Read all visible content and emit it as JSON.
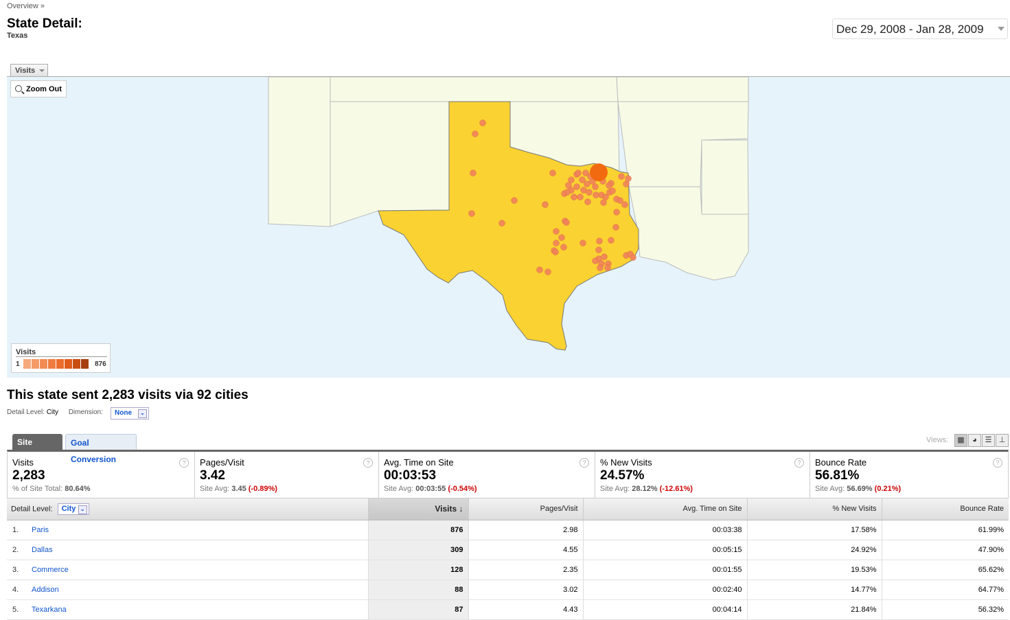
{
  "breadcrumb": "Overview »",
  "title": "State Detail:",
  "subtitle": "Texas",
  "date_range": "Dec 29, 2008 - Jan 28, 2009",
  "map": {
    "metric_tab": "Visits",
    "zoom_out_label": "Zoom Out",
    "legend": {
      "title": "Visits",
      "min": "1",
      "max": "876",
      "colors": [
        "#f6a97c",
        "#f49b69",
        "#f28c55",
        "#ef7c40",
        "#eb6c2c",
        "#e05c1c",
        "#c84e12",
        "#a64010"
      ]
    },
    "land_color": "#f7fbe6",
    "state_color": "#fad232",
    "water_color": "#e6f3fb",
    "marker_color": "#f0825a"
  },
  "summary": {
    "heading": "This state sent 2,283 visits via 92 cities",
    "detail_level_label": "Detail Level:",
    "detail_level_value": "City",
    "dimension_label": "Dimension:",
    "dimension_value": "None"
  },
  "tabs": {
    "site_usage": "Site Usage",
    "goal_conversion": "Goal Conversion"
  },
  "views_label": "Views:",
  "scorecard": [
    {
      "name": "Visits",
      "value": "2,283",
      "sub_label": "% of Site Total:",
      "sub_value": "80.64%",
      "sub_delta": ""
    },
    {
      "name": "Pages/Visit",
      "value": "3.42",
      "sub_label": "Site Avg:",
      "sub_value": "3.45",
      "sub_delta": "(-0.89%)"
    },
    {
      "name": "Avg. Time on Site",
      "value": "00:03:53",
      "sub_label": "Site Avg:",
      "sub_value": "00:03:55",
      "sub_delta": "(-0.54%)"
    },
    {
      "name": "% New Visits",
      "value": "24.57%",
      "sub_label": "Site Avg:",
      "sub_value": "28.12%",
      "sub_delta": "(-12.61%)"
    },
    {
      "name": "Bounce Rate",
      "value": "56.81%",
      "sub_label": "Site Avg:",
      "sub_value": "56.69%",
      "sub_delta": "(0.21%)"
    }
  ],
  "table": {
    "detail_label": "Detail Level:",
    "detail_value": "City",
    "columns": [
      "Visits ↓",
      "Pages/Visit",
      "Avg. Time on Site",
      "% New Visits",
      "Bounce Rate"
    ],
    "rows": [
      {
        "num": "1.",
        "city": "Paris",
        "visits": "876",
        "pages": "2.98",
        "time": "00:03:38",
        "new": "17.58%",
        "bounce": "61.99%"
      },
      {
        "num": "2.",
        "city": "Dallas",
        "visits": "309",
        "pages": "4.55",
        "time": "00:05:15",
        "new": "24.92%",
        "bounce": "47.90%"
      },
      {
        "num": "3.",
        "city": "Commerce",
        "visits": "128",
        "pages": "2.35",
        "time": "00:01:55",
        "new": "19.53%",
        "bounce": "65.62%"
      },
      {
        "num": "4.",
        "city": "Addison",
        "visits": "88",
        "pages": "3.02",
        "time": "00:02:40",
        "new": "14.77%",
        "bounce": "64.77%"
      },
      {
        "num": "5.",
        "city": "Texarkana",
        "visits": "87",
        "pages": "4.43",
        "time": "00:04:14",
        "new": "21.84%",
        "bounce": "56.32%"
      }
    ]
  }
}
